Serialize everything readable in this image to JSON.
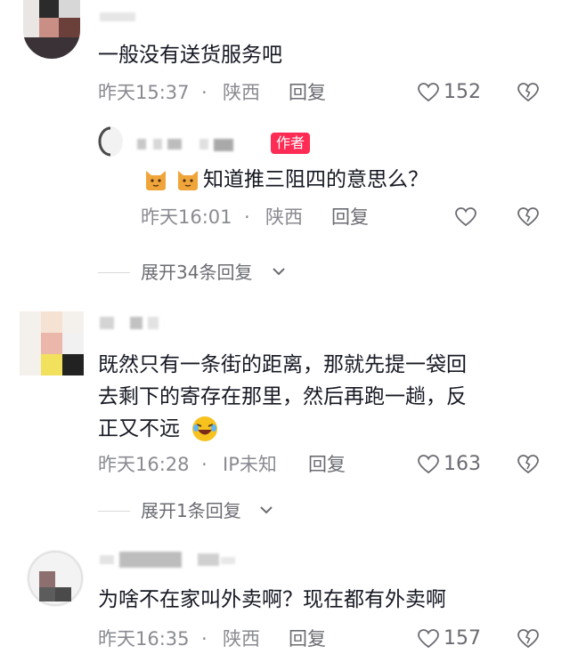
{
  "comments": [
    {
      "text_lines": [
        "一般没有送货服务吧"
      ],
      "time": "昨天15:37",
      "dot": "·",
      "location": "陕西",
      "reply": "回复",
      "likes": "152",
      "replies": [
        {
          "badge": "作者",
          "text": "知道推三阻四的意思么？",
          "time": "昨天16:01",
          "dot": "·",
          "location": "陕西",
          "reply": "回复"
        }
      ],
      "expand": "展开34条回复"
    },
    {
      "text_lines": [
        "既然只有一条街的距离，那就先提一袋回",
        "去剩下的寄存在那里，然后再跑一趟，反",
        "正又不远"
      ],
      "time": "昨天16:28",
      "dot": "·",
      "location": "IP未知",
      "reply": "回复",
      "likes": "163",
      "expand": "展开1条回复"
    },
    {
      "text_lines": [
        "为啥不在家叫外卖啊？现在都有外卖啊"
      ],
      "time": "昨天16:35",
      "dot": "·",
      "location": "陕西",
      "reply": "回复",
      "likes": "157"
    }
  ],
  "icons": {
    "like": "heart-outline-icon",
    "dislike": "broken-heart-icon",
    "expand": "chevron-down-icon",
    "emoji_cat": "cat-emoji-icon",
    "emoji_laugh": "laughing-emoji-icon"
  },
  "colors": {
    "badge": "#fe2c55",
    "meta": "#8a8b91",
    "text": "#161823"
  }
}
